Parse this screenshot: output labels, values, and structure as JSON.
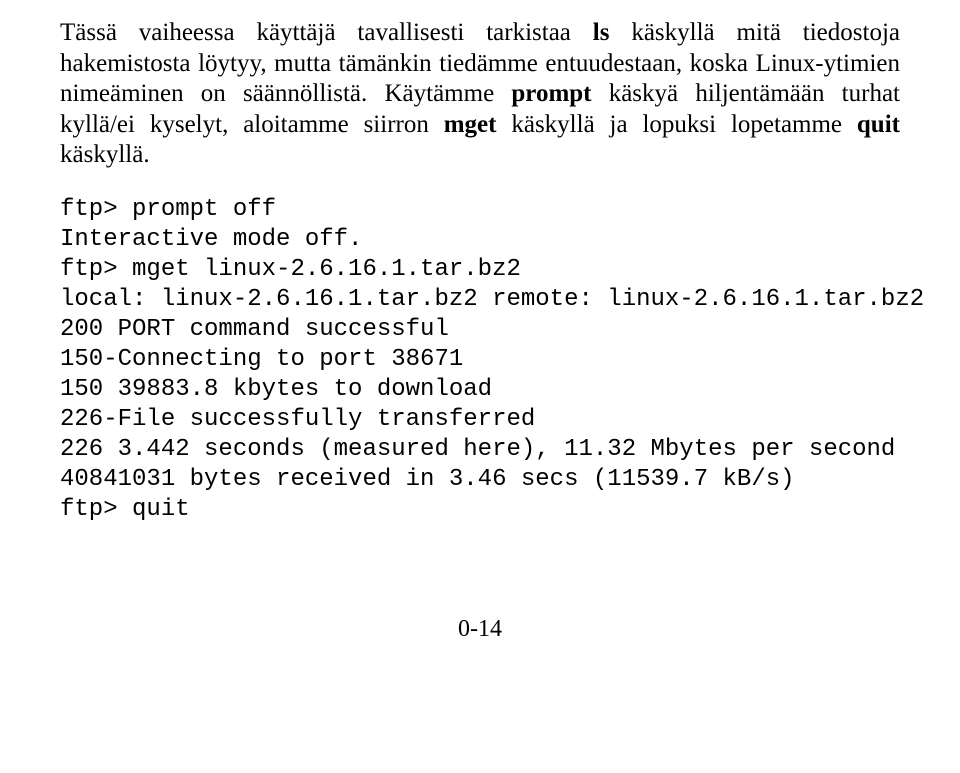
{
  "para": {
    "seg1": "Tässä vaiheessa käyttäjä tavallisesti tarkistaa ",
    "cmd_ls": "ls",
    "seg2": " käskyllä mitä tiedostoja hakemistosta löytyy, mutta tämänkin tiedämme entuudestaan, koska Linux-ytimien nimeäminen on säännöllistä. Käytämme ",
    "cmd_prompt": "prompt",
    "seg3": " käskyä hiljentämään turhat kyllä/ei kyselyt, aloitamme siirron ",
    "cmd_mget": "mget",
    "seg4": " käskyllä ja lopuksi lopetamme ",
    "cmd_quit": "quit",
    "seg5": " käskyllä."
  },
  "terminal": [
    "ftp> prompt off",
    "Interactive mode off.",
    "ftp> mget linux-2.6.16.1.tar.bz2",
    "local: linux-2.6.16.1.tar.bz2 remote: linux-2.6.16.1.tar.bz2",
    "200 PORT command successful",
    "150-Connecting to port 38671",
    "150 39883.8 kbytes to download",
    "226-File successfully transferred",
    "226 3.442 seconds (measured here), 11.32 Mbytes per second",
    "40841031 bytes received in 3.46 secs (11539.7 kB/s)",
    "ftp> quit"
  ],
  "page_number": "0-14"
}
